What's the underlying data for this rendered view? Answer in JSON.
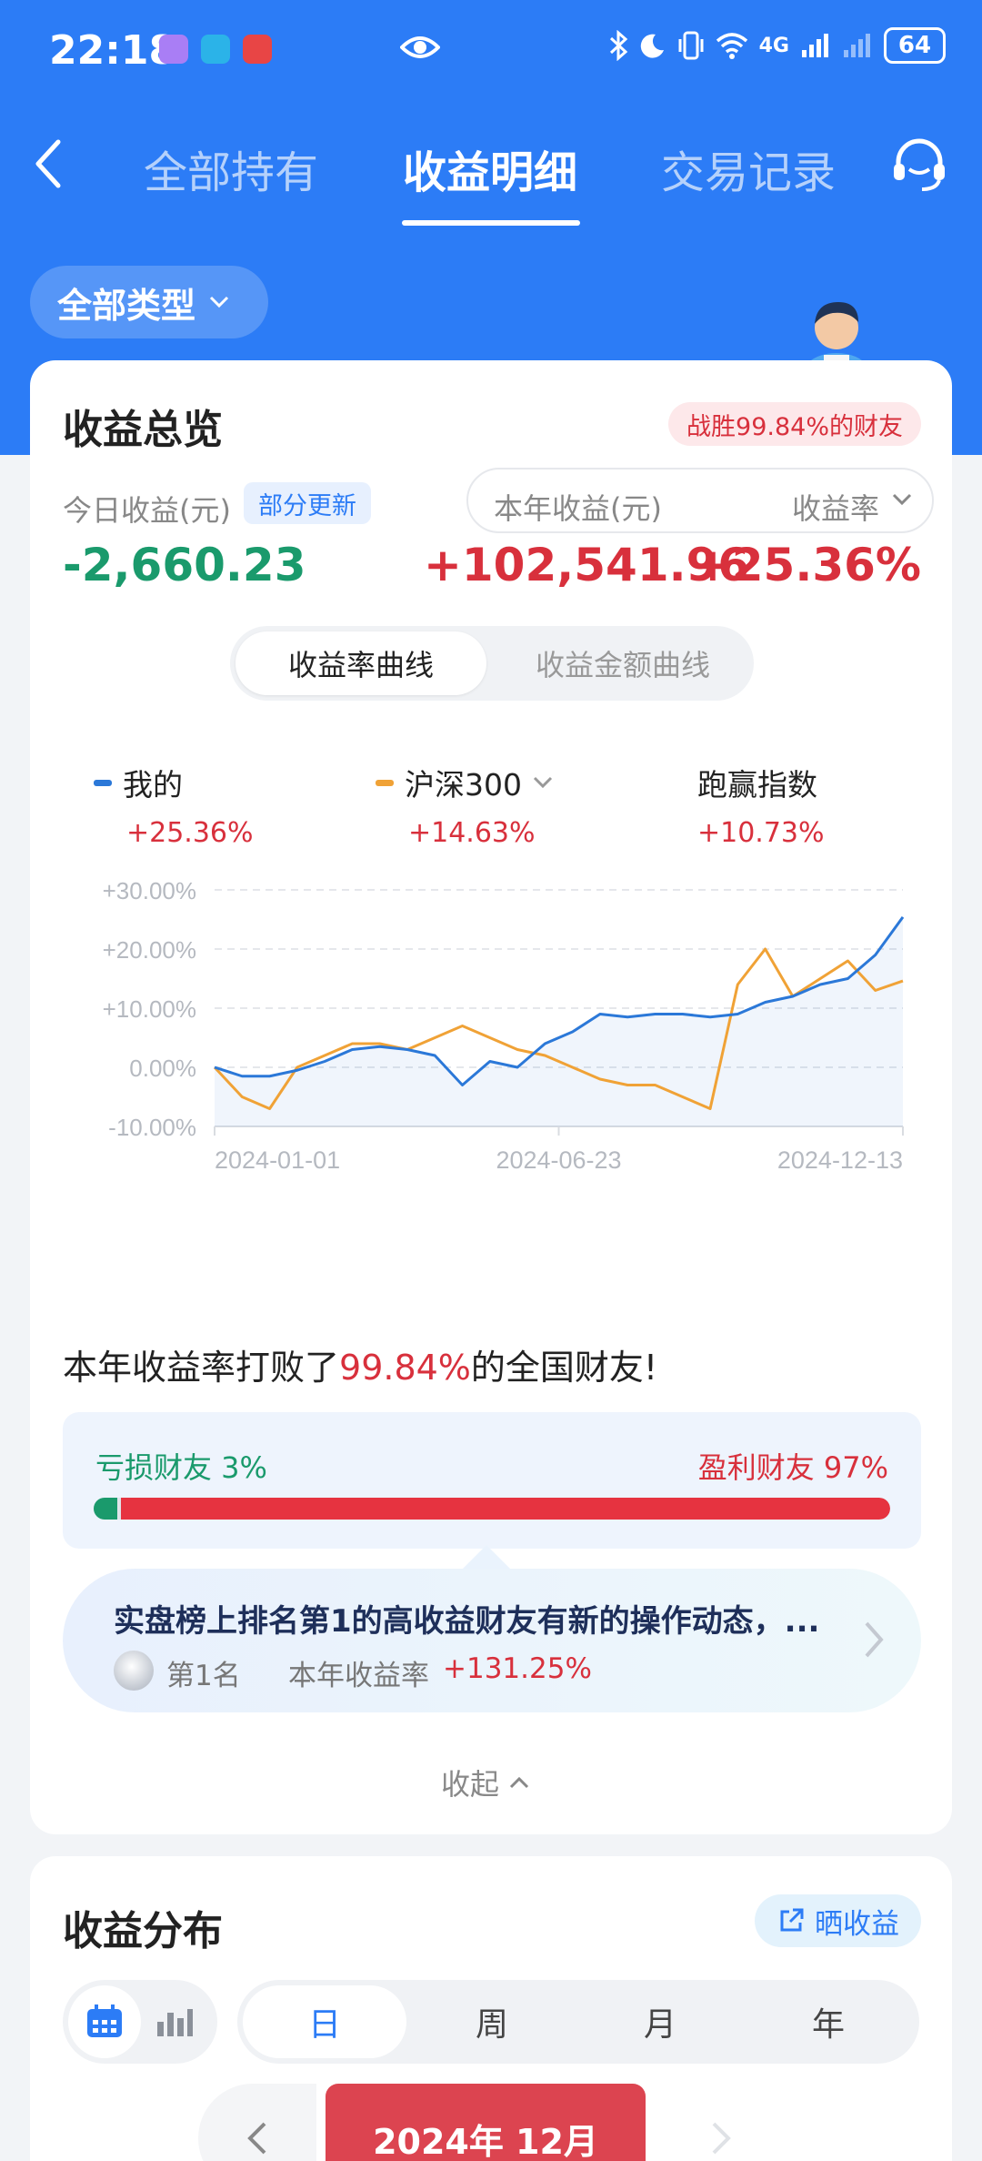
{
  "status_bar": {
    "time": "22:18",
    "network": "4G",
    "battery": "64"
  },
  "nav": {
    "tabs": [
      "全部持有",
      "收益明细",
      "交易记录"
    ],
    "active_tab": "收益明细"
  },
  "filter": {
    "label": "全部类型"
  },
  "overview": {
    "title": "收益总览",
    "win_badge": "战胜99.84%的财友",
    "today_label": "今日收益(元)",
    "partial_badge": "部分更新",
    "today_value": "-2,660.23",
    "year_label": "本年收益(元)",
    "rate_label": "收益率",
    "year_value": "+102,541.96",
    "rate_value": "+25.36%",
    "segments": [
      "收益率曲线",
      "收益金额曲线"
    ],
    "legend": [
      {
        "name": "我的",
        "value": "+25.36%",
        "color": "#2b78d8"
      },
      {
        "name": "沪深300",
        "value": "+14.63%",
        "color": "#f0a236"
      },
      {
        "name": "跑赢指数",
        "value": "+10.73%"
      }
    ]
  },
  "chart_data": {
    "type": "line",
    "title": "",
    "xlabel": "",
    "ylabel": "",
    "ylim": [
      -10,
      30
    ],
    "yticks": [
      "+30.00%",
      "+20.00%",
      "+10.00%",
      "0.00%",
      "-10.00%"
    ],
    "xticks": [
      "2024-01-01",
      "2024-06-23",
      "2024-12-13"
    ],
    "x": [
      0,
      4,
      8,
      12,
      16,
      20,
      24,
      28,
      32,
      36,
      40,
      44,
      48,
      52,
      56,
      60,
      64,
      68,
      72,
      76,
      80,
      84,
      88,
      92,
      96,
      100
    ],
    "series": [
      {
        "name": "我的",
        "color": "#2b78d8",
        "values": [
          0,
          -1.5,
          -1.5,
          -0.5,
          1,
          3,
          3.5,
          3,
          2,
          -3,
          1,
          0,
          4,
          6,
          9,
          8.5,
          9,
          9,
          8.5,
          9,
          11,
          12,
          14,
          15,
          19,
          25.4
        ]
      },
      {
        "name": "沪深300",
        "color": "#f0a236",
        "values": [
          0,
          -5,
          -7,
          0,
          2,
          4,
          4,
          3,
          5,
          7,
          5,
          3,
          2,
          0,
          -2,
          -3,
          -3,
          -5,
          -7,
          14,
          20,
          12,
          15,
          18,
          13,
          14.6
        ]
      }
    ]
  },
  "beat": {
    "prefix": "本年收益率打败了",
    "pct": "99.84%",
    "suffix": "的全国财友!"
  },
  "distribution_bar": {
    "loss_label": "亏损财友 3%",
    "profit_label": "盈利财友 97%",
    "loss_share": 0.03
  },
  "dynamic": {
    "title": "实盘榜上排名第1的高收益财友有新的操作动态，...",
    "rank": "第1名",
    "rate_label": "本年收益率",
    "rate_value": "+131.25%"
  },
  "collapse_label": "收起",
  "distribution": {
    "title": "收益分布",
    "share_label": "晒收益",
    "periods": [
      "日",
      "周",
      "月",
      "年"
    ],
    "active_period": "日",
    "month": "2024年 12月"
  }
}
